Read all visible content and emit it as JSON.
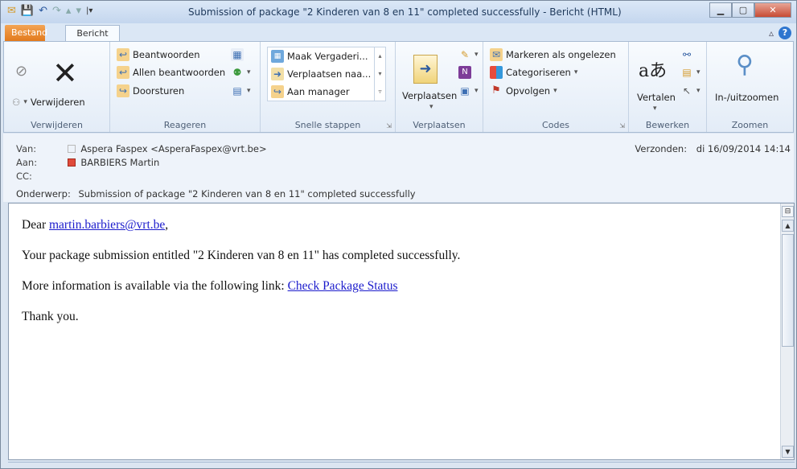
{
  "window": {
    "title": "Submission of package \"2 Kinderen van 8 en 11\" completed successfully  -  Bericht (HTML)"
  },
  "tabs": {
    "file": "Bestand",
    "message": "Bericht"
  },
  "ribbon": {
    "delete_group": {
      "delete": "Verwijderen",
      "label": "Verwijderen"
    },
    "respond_group": {
      "reply": "Beantwoorden",
      "reply_all": "Allen beantwoorden",
      "forward": "Doorsturen",
      "label": "Reageren"
    },
    "quick_steps_group": {
      "items": [
        "Maak Vergaderi...",
        "Verplaatsen naa...",
        "Aan manager"
      ],
      "label": "Snelle stappen"
    },
    "move_group": {
      "move": "Verplaatsen",
      "label": "Verplaatsen"
    },
    "tags_group": {
      "mark_unread": "Markeren als ongelezen",
      "categorize": "Categoriseren",
      "follow_up": "Opvolgen",
      "label": "Codes"
    },
    "editing_group": {
      "translate": "Vertalen",
      "label": "Bewerken"
    },
    "zoom_group": {
      "zoom": "In-/uitzoomen",
      "label": "Zoomen"
    }
  },
  "header": {
    "from_label": "Van:",
    "from_value": "Aspera Faspex <AsperaFaspex@vrt.be>",
    "to_label": "Aan:",
    "to_value": "BARBIERS Martin",
    "cc_label": "CC:",
    "subject_label": "Onderwerp:",
    "subject_value": "Submission of package \"2 Kinderen van 8 en 11\" completed successfully",
    "sent_label": "Verzonden:",
    "sent_value": "di 16/09/2014 14:14"
  },
  "body": {
    "greeting_prefix": "Dear ",
    "greeting_link": "martin.barbiers@vrt.be",
    "greeting_suffix": ",",
    "line1": "Your package submission entitled \"2 Kinderen van 8 en 11\" has completed successfully.",
    "line2_prefix": "More information is available via the following link: ",
    "line2_link": "Check Package Status",
    "line3": "Thank you."
  },
  "colors": {
    "file_tab": "#e27a1d",
    "link": "#1b1bcc",
    "close_button": "#c74b34"
  }
}
